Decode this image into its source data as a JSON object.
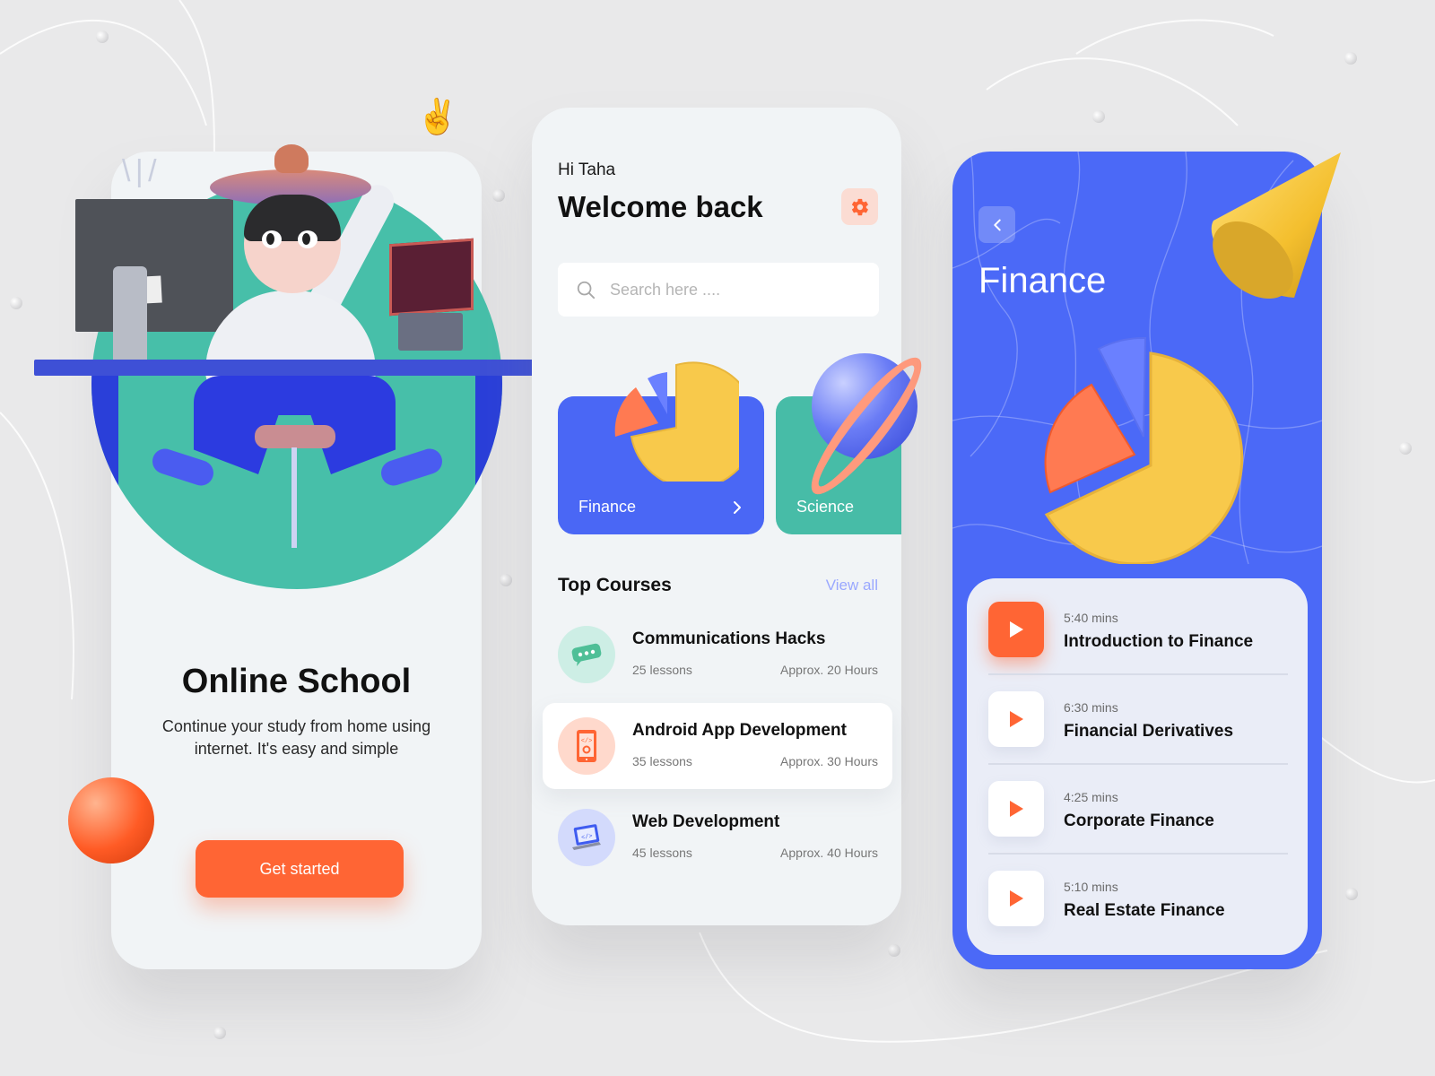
{
  "screen_onboarding": {
    "title": "Online School",
    "subtitle": "Continue your study from home using internet. It's easy and simple",
    "cta_label": "Get started"
  },
  "screen_home": {
    "greeting": "Hi Taha",
    "heading": "Welcome back",
    "settings_icon": "gear-icon",
    "search": {
      "placeholder": "Search here ....",
      "value": "",
      "icon": "search-icon"
    },
    "categories": [
      {
        "label": "Finance",
        "color": "#4a67f5",
        "icon": "chevron-right-icon"
      },
      {
        "label": "Science",
        "color": "#47bca7"
      }
    ],
    "section_title": "Top Courses",
    "view_all_label": "View all",
    "courses": [
      {
        "title": "Communications Hacks",
        "lessons": "25 lessons",
        "duration": "Approx. 20 Hours",
        "icon": "chat-bubble-icon",
        "icon_bg": "#cdeee5"
      },
      {
        "title": "Android App Development",
        "lessons": "35 lessons",
        "duration": "Approx. 30 Hours",
        "icon": "mobile-dev-icon",
        "icon_bg": "#ffd9cc",
        "selected": true
      },
      {
        "title": "Web Development",
        "lessons": "45 lessons",
        "duration": "Approx. 40 Hours",
        "icon": "laptop-code-icon",
        "icon_bg": "#d3dafc"
      }
    ]
  },
  "screen_finance": {
    "back_icon": "chevron-left-icon",
    "title": "Finance",
    "lessons": [
      {
        "duration": "5:40 mins",
        "title": "Introduction to Finance",
        "active": true
      },
      {
        "duration": "6:30 mins",
        "title": "Financial Derivatives",
        "active": false
      },
      {
        "duration": "4:25 mins",
        "title": "Corporate Finance",
        "active": false
      },
      {
        "duration": "5:10 mins",
        "title": "Real Estate Finance",
        "active": false
      }
    ]
  },
  "colors": {
    "accent_orange": "#ff6534",
    "primary_blue": "#4b69f7",
    "teal": "#47bca7",
    "pie_yellow": "#f8c94b",
    "pie_orange": "#ff7a52",
    "pie_blue": "#6a80ff"
  }
}
